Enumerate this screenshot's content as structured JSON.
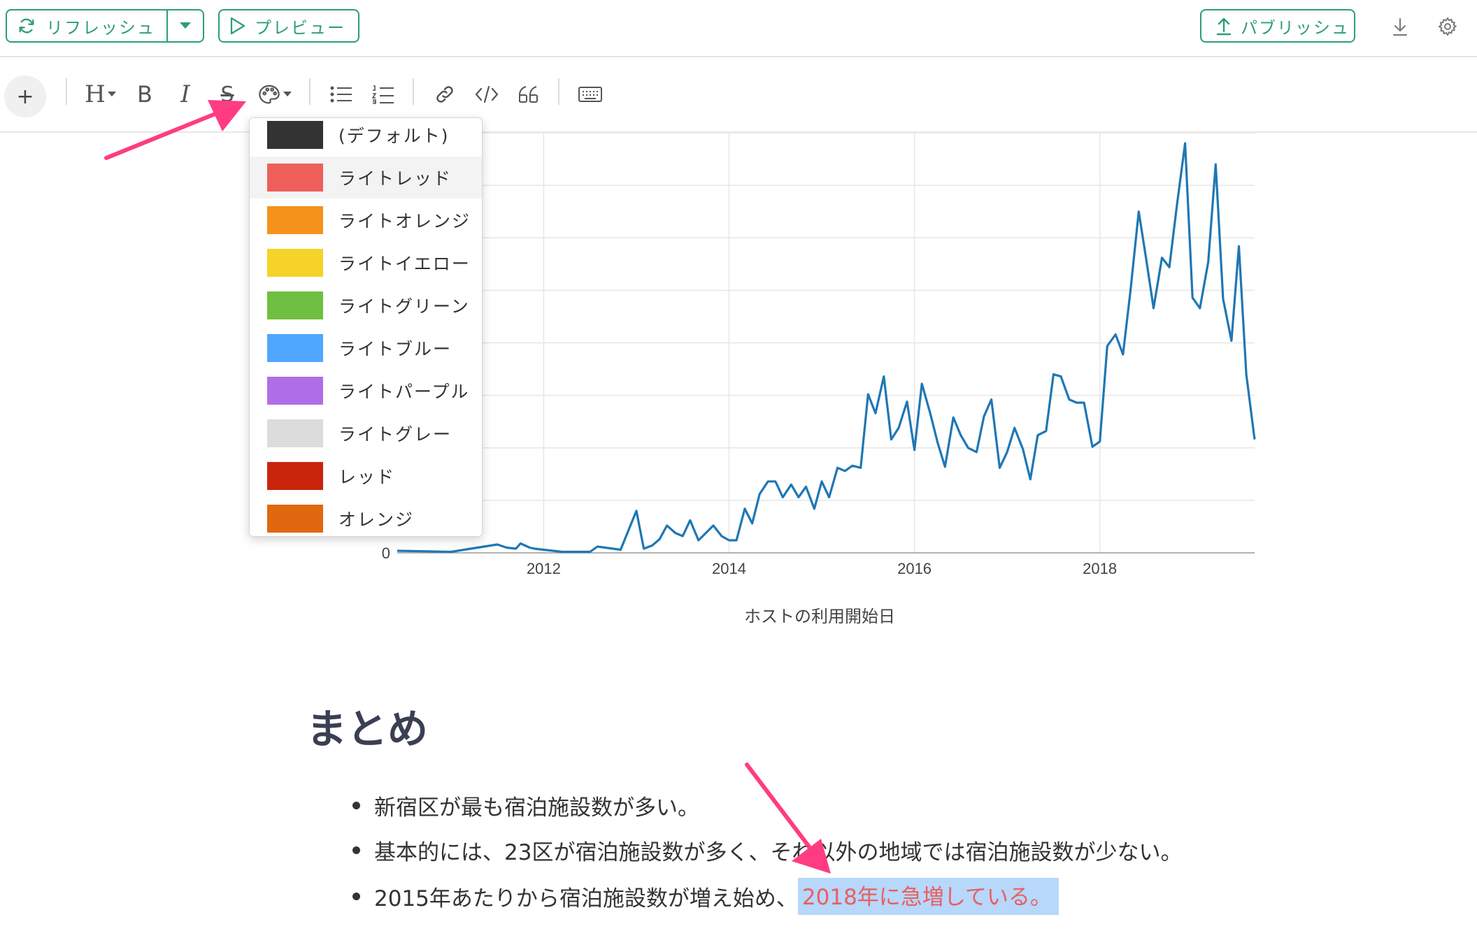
{
  "topbar": {
    "refresh_label": "リフレッシュ",
    "preview_label": "プレビュー",
    "publish_label": "パブリッシュ",
    "accent_color": "#2b9f72"
  },
  "toolbar": {
    "add_label": "+",
    "heading_label": "H",
    "bold_label": "B",
    "italic_label": "I",
    "strike_label": "S",
    "icons": [
      "plus-icon",
      "heading-icon",
      "bold-icon",
      "italic-icon",
      "strikethrough-icon",
      "palette-icon",
      "bullet-list-icon",
      "numbered-list-icon",
      "link-icon",
      "code-icon",
      "quote-icon",
      "keyboard-icon"
    ]
  },
  "color_menu": {
    "items": [
      {
        "label": "(デフォルト)",
        "color": "#333333"
      },
      {
        "label": "ライトレッド",
        "color": "#ee5f5b"
      },
      {
        "label": "ライトオレンジ",
        "color": "#f5921b"
      },
      {
        "label": "ライトイエロー",
        "color": "#f5d328"
      },
      {
        "label": "ライトグリーン",
        "color": "#6fbf40"
      },
      {
        "label": "ライトブルー",
        "color": "#4fa7ff"
      },
      {
        "label": "ライトパープル",
        "color": "#b06ee6"
      },
      {
        "label": "ライトグレー",
        "color": "#dcdcdc"
      },
      {
        "label": "レッド",
        "color": "#c8250c"
      },
      {
        "label": "オレンジ",
        "color": "#e0680f"
      }
    ]
  },
  "chart_data": {
    "type": "line",
    "xlabel": "ホストの利用開始日",
    "x_ticks": [
      "2012",
      "2014",
      "2016",
      "2018"
    ],
    "y_ticks": [
      "0"
    ],
    "grid": true,
    "color": "#1f77b4",
    "x": [
      2010.42,
      2011.0,
      2011.5,
      2011.6,
      2011.7,
      2011.75,
      2011.85,
      2011.9,
      2012.0,
      2012.2,
      2012.5,
      2012.58,
      2012.83,
      2013.0,
      2013.08,
      2013.17,
      2013.25,
      2013.33,
      2013.42,
      2013.5,
      2013.58,
      2013.67,
      2013.75,
      2013.83,
      2013.92,
      2014.0,
      2014.08,
      2014.17,
      2014.25,
      2014.33,
      2014.42,
      2014.5,
      2014.58,
      2014.67,
      2014.75,
      2014.83,
      2014.92,
      2015.0,
      2015.08,
      2015.17,
      2015.25,
      2015.33,
      2015.42,
      2015.5,
      2015.58,
      2015.67,
      2015.75,
      2015.83,
      2015.92,
      2016.0,
      2016.08,
      2016.17,
      2016.25,
      2016.33,
      2016.42,
      2016.5,
      2016.58,
      2016.67,
      2016.75,
      2016.83,
      2016.92,
      2017.0,
      2017.08,
      2017.17,
      2017.25,
      2017.33,
      2017.42,
      2017.5,
      2017.58,
      2017.67,
      2017.75,
      2017.83,
      2017.92,
      2018.0,
      2018.08,
      2018.17,
      2018.25,
      2018.33,
      2018.42,
      2018.5,
      2018.58,
      2018.67,
      2018.75,
      2018.83,
      2018.92,
      2019.0,
      2019.08,
      2019.17,
      2019.25,
      2019.33,
      2019.42,
      2019.5,
      2019.58,
      2019.67
    ],
    "y": [
      0.2,
      0.1,
      0.8,
      0.5,
      0.4,
      0.9,
      0.5,
      0.4,
      0.3,
      0.1,
      0.1,
      0.6,
      0.3,
      4.0,
      0.4,
      0.7,
      1.3,
      2.6,
      1.9,
      1.6,
      3.1,
      1.2,
      1.9,
      2.6,
      1.6,
      1.2,
      1.2,
      4.2,
      2.8,
      5.6,
      6.8,
      6.8,
      5.3,
      6.5,
      5.3,
      6.3,
      4.2,
      6.8,
      5.3,
      8.1,
      7.8,
      8.3,
      8.1,
      15.1,
      13.3,
      16.8,
      10.8,
      11.9,
      14.4,
      9.8,
      16.1,
      13.3,
      10.5,
      8.2,
      12.9,
      11.2,
      10.0,
      9.6,
      13.0,
      14.6,
      8.1,
      9.6,
      11.9,
      9.9,
      7.0,
      11.2,
      11.6,
      17.0,
      16.8,
      14.6,
      14.3,
      14.3,
      10.1,
      10.6,
      19.7,
      20.8,
      18.9,
      24.9,
      32.5,
      28.0,
      23.3,
      28.1,
      27.2,
      33.0,
      39.0,
      24.3,
      23.3,
      27.7,
      37.0,
      24.2,
      20.2,
      29.2,
      17.0,
      10.8
    ],
    "ylim": [
      0,
      40
    ]
  },
  "content": {
    "heading": "まとめ",
    "bullets": [
      "新宿区が最も宿泊施設数が多い。",
      "基本的には、23区が宿泊施設数が多く、それ以外の地域では宿泊施設数が少ない。"
    ],
    "bullet3_prefix": "2015年あたりから宿泊施設数が増え始め、",
    "bullet3_highlight": "2018年に急増している。",
    "highlight_text_color": "#e95f5f",
    "selection_color": "#b7d7fb"
  }
}
